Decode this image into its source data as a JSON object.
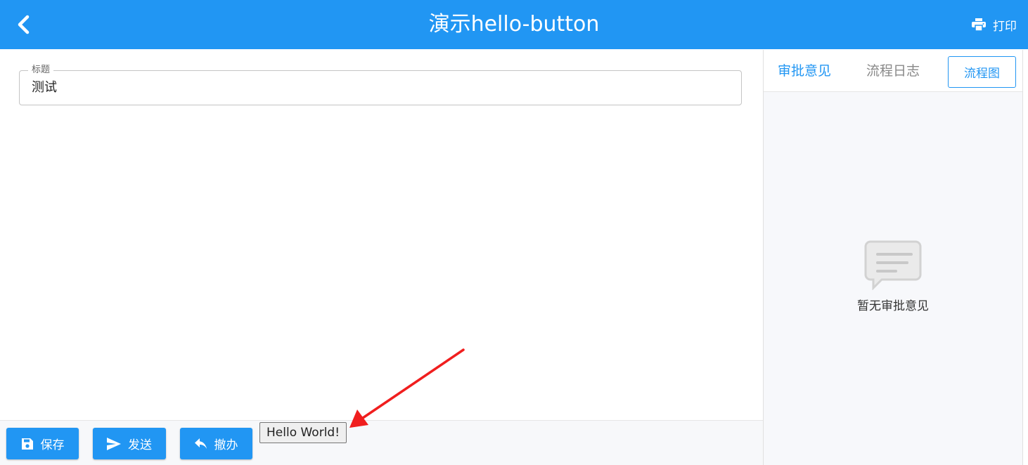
{
  "header": {
    "title": "演示hello-button",
    "print_label": "打印"
  },
  "form": {
    "title_legend": "标题",
    "title_value": "测试"
  },
  "actions": {
    "save_label": "保存",
    "send_label": "发送",
    "revoke_label": "撤办",
    "hello_label": "Hello World!"
  },
  "side": {
    "tabs": [
      "审批意见",
      "流程日志"
    ],
    "flow_button": "流程图",
    "empty_text": "暂无审批意见"
  },
  "colors": {
    "primary": "#2196f3",
    "annotation_arrow": "#f01e1e"
  }
}
